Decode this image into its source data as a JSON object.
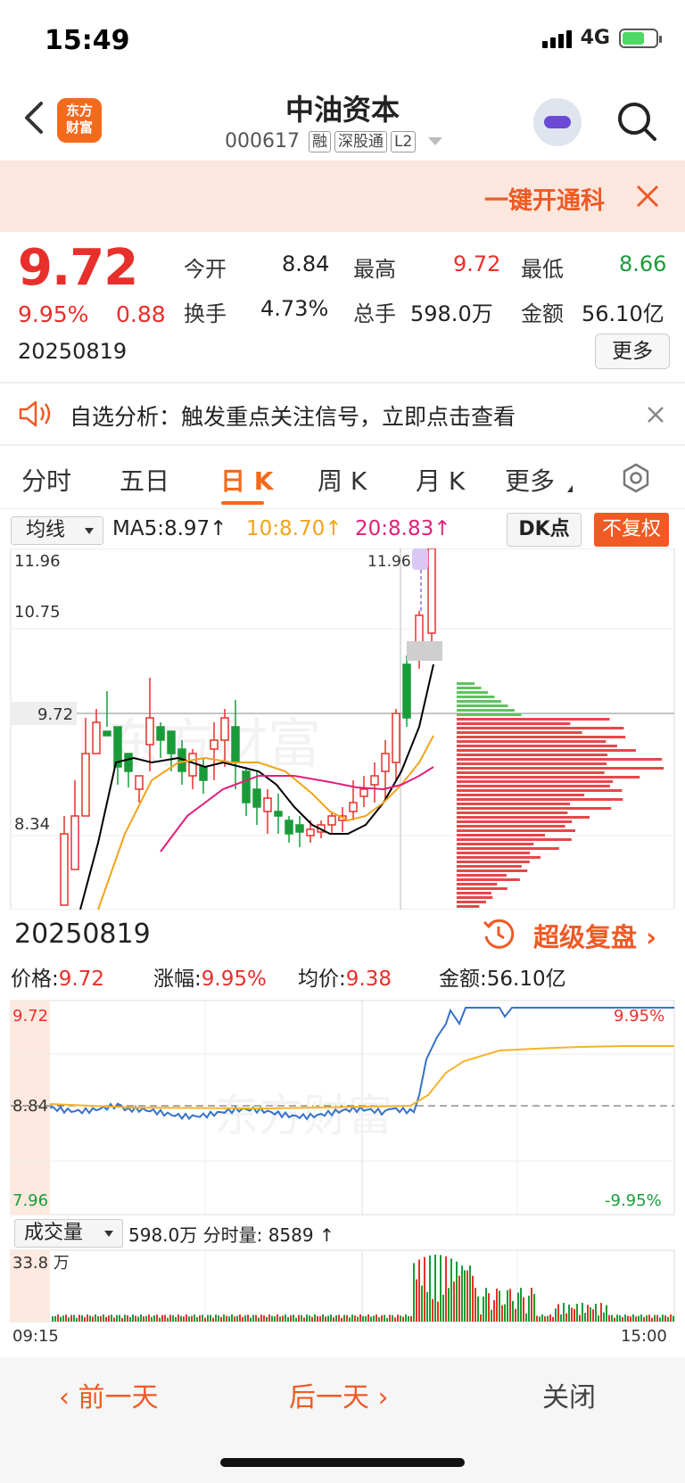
{
  "status": {
    "time": "15:49",
    "network": "4G"
  },
  "header": {
    "title": "中油资本",
    "code": "000617",
    "tags": [
      "融",
      "深股通",
      "L2"
    ],
    "logo_line1": "东方",
    "logo_line2": "财富"
  },
  "promo": {
    "text": "一键开通科"
  },
  "quote": {
    "price": "9.72",
    "change_pct": "9.95%",
    "change": "0.88",
    "date": "20250819",
    "open_label": "今开",
    "open": "8.84",
    "high_label": "最高",
    "high": "9.72",
    "low_label": "最低",
    "low": "8.66",
    "turnover_label": "换手",
    "turnover": "4.73%",
    "volume_label": "总手",
    "volume": "598.0万",
    "amount_label": "金额",
    "amount": "56.10亿",
    "more": "更多"
  },
  "notice": {
    "text": "自选分析：触发重点关注信号，立即点击查看"
  },
  "tabs": [
    "分时",
    "五日",
    "日 K",
    "周 K",
    "月 K",
    "更多"
  ],
  "active_tab": "日 K",
  "ma": {
    "select": "均线",
    "ma5": "MA5:8.97↑",
    "ma10": "10:8.70↑",
    "ma20": "20:8.83↑",
    "dk": "DK点",
    "fq": "不复权"
  },
  "colors": {
    "up": "#e7302b",
    "down": "#1a9b3a",
    "accent": "#f46a1c",
    "ma5": "#000000",
    "ma10": "#f2a31b",
    "ma20": "#e0207a",
    "price_line": "#3572c8",
    "avg_line": "#f5b32c"
  },
  "kline": {
    "y_labels": [
      "11.96",
      "10.75",
      "9.72",
      "8.34"
    ],
    "high_marker": "11.96",
    "watermark": "东方财富"
  },
  "chart_data": {
    "type": "line",
    "title": "",
    "x": [
      "09:15",
      "15:00"
    ],
    "ylim": [
      7.96,
      9.72
    ],
    "y_labels": [
      "9.72",
      "8.84",
      "7.96"
    ],
    "right_labels": [
      "9.95%",
      "-9.95%"
    ],
    "series": []
  },
  "replay": {
    "date": "20250819",
    "text": "超级复盘"
  },
  "stats": {
    "price_label": "价格:",
    "price": "9.72",
    "pct_label": "涨幅:",
    "pct": "9.95%",
    "avg_label": "均价:",
    "avg": "9.38",
    "amount_label": "金额:",
    "amount": "56.10亿"
  },
  "volume": {
    "select": "成交量",
    "info": "598.0万 分时量: 8589 ↑",
    "max_label": "33.8 万",
    "start": "09:15",
    "end": "15:00"
  },
  "footer": {
    "prev": "前一天",
    "next": "后一天",
    "close": "关闭"
  }
}
